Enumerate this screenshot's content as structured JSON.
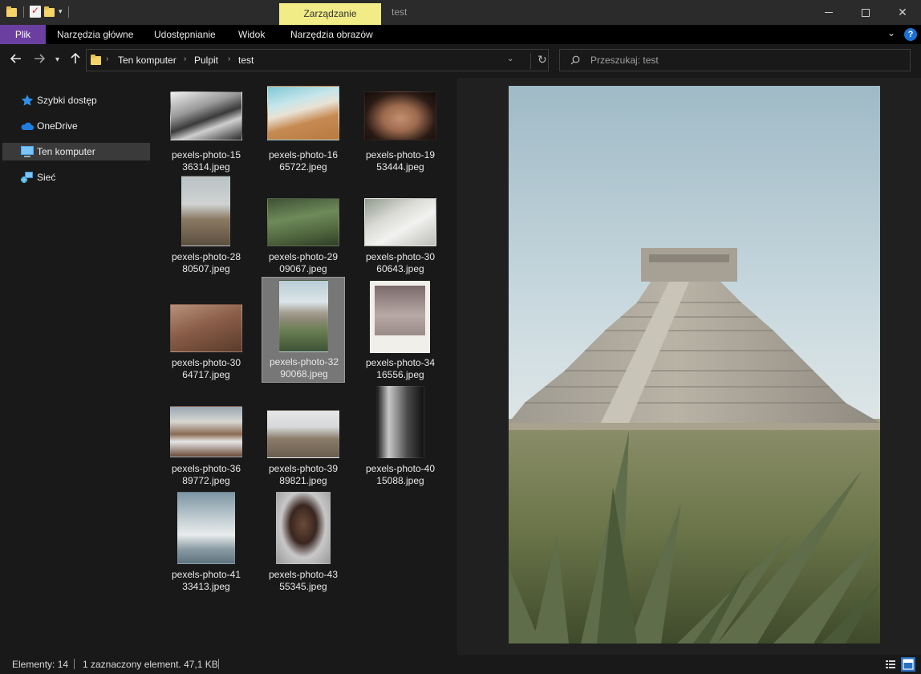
{
  "titlebar": {
    "context_tab": "Zarządzanie",
    "window_title": "test"
  },
  "ribbon": {
    "tabs": [
      "Plik",
      "Narzędzia główne",
      "Udostępnianie",
      "Widok",
      "Narzędzia obrazów"
    ],
    "help": "?"
  },
  "address": {
    "breadcrumbs": [
      "Ten komputer",
      "Pulpit",
      "test"
    ]
  },
  "search": {
    "placeholder": "Przeszukaj: test"
  },
  "sidebar": {
    "items": [
      {
        "label": "Szybki dostęp",
        "icon": "star-icon"
      },
      {
        "label": "OneDrive",
        "icon": "cloud-icon"
      },
      {
        "label": "Ten komputer",
        "icon": "computer-icon"
      },
      {
        "label": "Sieć",
        "icon": "network-icon"
      }
    ]
  },
  "files": [
    {
      "name": "pexels-photo-1536314.jpeg",
      "line1": "pexels-photo-15",
      "line2": "36314.jpeg"
    },
    {
      "name": "pexels-photo-1665722.jpeg",
      "line1": "pexels-photo-16",
      "line2": "65722.jpeg"
    },
    {
      "name": "pexels-photo-1953444.jpeg",
      "line1": "pexels-photo-19",
      "line2": "53444.jpeg"
    },
    {
      "name": "pexels-photo-2880507.jpeg",
      "line1": "pexels-photo-28",
      "line2": "80507.jpeg"
    },
    {
      "name": "pexels-photo-2909067.jpeg",
      "line1": "pexels-photo-29",
      "line2": "09067.jpeg"
    },
    {
      "name": "pexels-photo-3060643.jpeg",
      "line1": "pexels-photo-30",
      "line2": "60643.jpeg"
    },
    {
      "name": "pexels-photo-3064717.jpeg",
      "line1": "pexels-photo-30",
      "line2": "64717.jpeg"
    },
    {
      "name": "pexels-photo-3290068.jpeg",
      "line1": "pexels-photo-32",
      "line2": "90068.jpeg"
    },
    {
      "name": "pexels-photo-3416556.jpeg",
      "line1": "pexels-photo-34",
      "line2": "16556.jpeg"
    },
    {
      "name": "pexels-photo-3689772.jpeg",
      "line1": "pexels-photo-36",
      "line2": "89772.jpeg"
    },
    {
      "name": "pexels-photo-3989821.jpeg",
      "line1": "pexels-photo-39",
      "line2": "89821.jpeg"
    },
    {
      "name": "pexels-photo-4015088.jpeg",
      "line1": "pexels-photo-40",
      "line2": "15088.jpeg"
    },
    {
      "name": "pexels-photo-4133413.jpeg",
      "line1": "pexels-photo-41",
      "line2": "33413.jpeg"
    },
    {
      "name": "pexels-photo-4355345.jpeg",
      "line1": "pexels-photo-43",
      "line2": "55345.jpeg"
    }
  ],
  "status": {
    "count": "Elementy: 14",
    "selection": "1 zaznaczony element. 47,1 KB"
  },
  "colors": {
    "background": "#191919",
    "file_tab": "#6b3fa0",
    "context_tab": "#f2ec87",
    "selected_tile": "#777777",
    "accent": "#2b6fc0"
  }
}
